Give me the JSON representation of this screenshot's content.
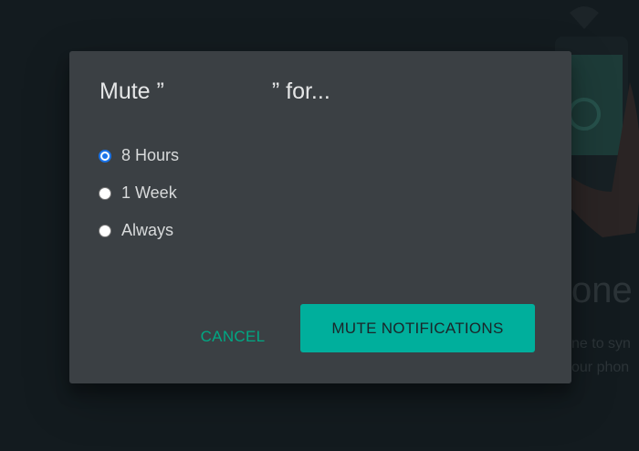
{
  "background": {
    "title_fragment": "one",
    "text_line_1": "ne to syn",
    "text_line_2": "our phon"
  },
  "dialog": {
    "title_prefix": "Mute ”",
    "title_suffix": "” for...",
    "options": [
      {
        "label": "8 Hours",
        "checked": true
      },
      {
        "label": "1 Week",
        "checked": false
      },
      {
        "label": "Always",
        "checked": false
      }
    ],
    "cancel_label": "CANCEL",
    "confirm_label": "MUTE NOTIFICATIONS"
  },
  "colors": {
    "accent": "#00a884",
    "button_bg": "#00af9c",
    "dialog_bg": "#3b4044",
    "backdrop": "#131b1f",
    "radio_checked": "#1a73e8"
  }
}
